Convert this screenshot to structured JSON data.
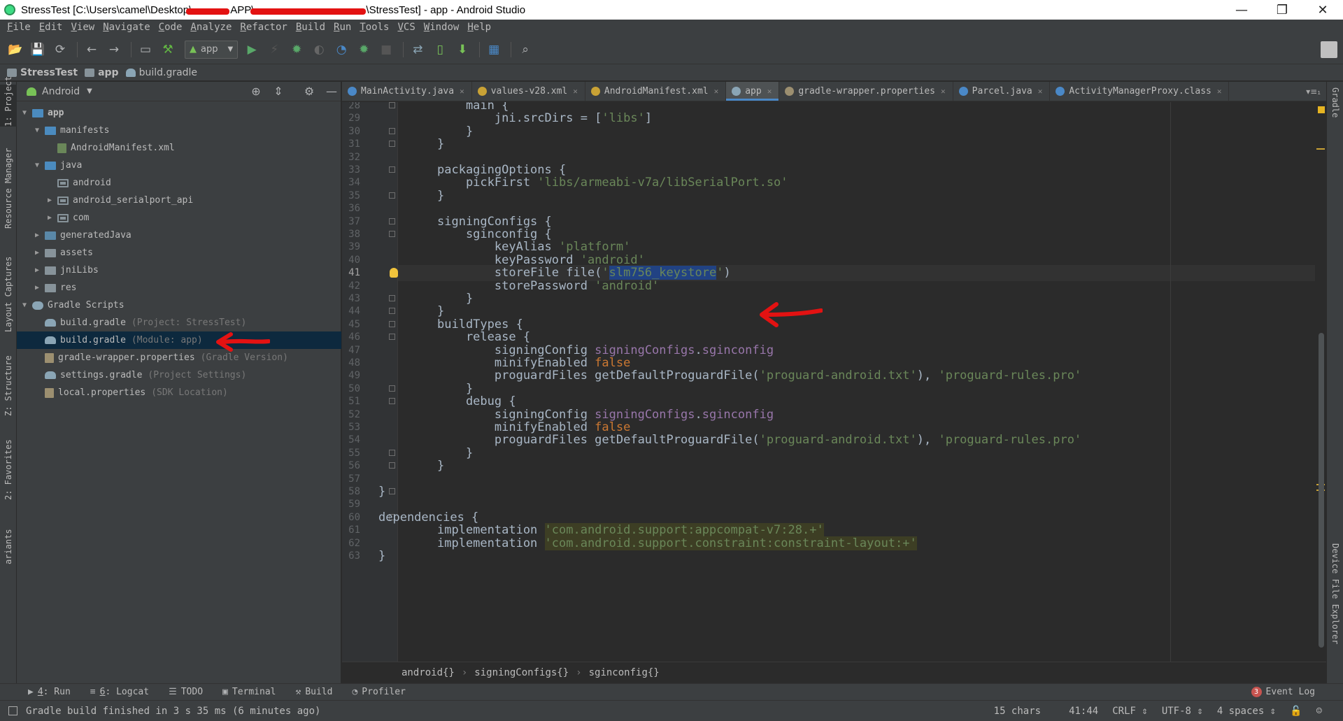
{
  "window": {
    "title_parts": [
      "StressTest [C:\\Users\\camel\\Desktop\\",
      "APP\\",
      "\\StressTest] - app - Android Studio"
    ],
    "controls": [
      "—",
      "❐",
      "✕"
    ]
  },
  "menu": [
    "File",
    "Edit",
    "View",
    "Navigate",
    "Code",
    "Analyze",
    "Refactor",
    "Build",
    "Run",
    "Tools",
    "VCS",
    "Window",
    "Help"
  ],
  "toolbar": {
    "run_config": "app"
  },
  "breadcrumb": [
    "StressTest",
    "app",
    "build.gradle"
  ],
  "left_strip": [
    "1: Project",
    "Resource Manager",
    "Layout Captures",
    "Z: Structure",
    "2: Favorites",
    "ariants"
  ],
  "right_strip": [
    "Gradle",
    "Device File Explorer"
  ],
  "project": {
    "view": "Android",
    "tree": [
      {
        "label": "app",
        "hint": "",
        "arrow": "▼",
        "level": 0,
        "icon": "folder-src",
        "bold": true
      },
      {
        "label": "manifests",
        "hint": "",
        "arrow": "▼",
        "level": 1,
        "icon": "folder-src"
      },
      {
        "label": "AndroidManifest.xml",
        "hint": "",
        "arrow": "",
        "level": 2,
        "icon": "manifest"
      },
      {
        "label": "java",
        "hint": "",
        "arrow": "▼",
        "level": 1,
        "icon": "folder-src"
      },
      {
        "label": "android",
        "hint": "",
        "arrow": "",
        "level": 2,
        "icon": "folder-pkg"
      },
      {
        "label": "android_serialport_api",
        "hint": "",
        "arrow": "▶",
        "level": 2,
        "icon": "folder-pkg"
      },
      {
        "label": "com",
        "hint": "",
        "arrow": "▶",
        "level": 2,
        "icon": "folder-pkg"
      },
      {
        "label": "generatedJava",
        "hint": "",
        "arrow": "▶",
        "level": 1,
        "icon": "folder-gen"
      },
      {
        "label": "assets",
        "hint": "",
        "arrow": "▶",
        "level": 1,
        "icon": "folder"
      },
      {
        "label": "jniLibs",
        "hint": "",
        "arrow": "▶",
        "level": 1,
        "icon": "folder"
      },
      {
        "label": "res",
        "hint": "",
        "arrow": "▶",
        "level": 1,
        "icon": "folder"
      },
      {
        "label": "Gradle Scripts",
        "hint": "",
        "arrow": "▼",
        "level": 0,
        "icon": "gscripts"
      },
      {
        "label": "build.gradle",
        "hint": "(Project: StressTest)",
        "arrow": "",
        "level": 1,
        "icon": "gradle"
      },
      {
        "label": "build.gradle",
        "hint": "(Module: app)",
        "arrow": "",
        "level": 1,
        "icon": "gradle",
        "selected": true
      },
      {
        "label": "gradle-wrapper.properties",
        "hint": "(Gradle Version)",
        "arrow": "",
        "level": 1,
        "icon": "props"
      },
      {
        "label": "settings.gradle",
        "hint": "(Project Settings)",
        "arrow": "",
        "level": 1,
        "icon": "gradle"
      },
      {
        "label": "local.properties",
        "hint": "(SDK Location)",
        "arrow": "",
        "level": 1,
        "icon": "props"
      }
    ]
  },
  "tabs": [
    {
      "label": "MainActivity.java",
      "color": "#4a88c7"
    },
    {
      "label": "values-v28.xml",
      "color": "#c9a235"
    },
    {
      "label": "AndroidManifest.xml",
      "color": "#c9a235"
    },
    {
      "label": "app",
      "color": "#8aa5b5",
      "active": true
    },
    {
      "label": "gradle-wrapper.properties",
      "color": "#9c8f70"
    },
    {
      "label": "Parcel.java",
      "color": "#4a88c7"
    },
    {
      "label": "ActivityManagerProxy.class",
      "color": "#4a88c7"
    }
  ],
  "tabs_overflow": "▾≡₁",
  "editor": {
    "current_line": 41,
    "lines": [
      {
        "n": 28,
        "fold": true,
        "segs": [
          [
            "    main {",
            ""
          ]
        ]
      },
      {
        "n": 29,
        "segs": [
          [
            "        jni.srcDirs = [",
            ""
          ],
          [
            "'libs'",
            "str"
          ],
          [
            "]",
            ""
          ]
        ]
      },
      {
        "n": 30,
        "fold": true,
        "segs": [
          [
            "    }",
            ""
          ]
        ]
      },
      {
        "n": 31,
        "fold": true,
        "segs": [
          [
            "}",
            ""
          ]
        ]
      },
      {
        "n": 32,
        "segs": [
          [
            "",
            ""
          ]
        ]
      },
      {
        "n": 33,
        "fold": true,
        "segs": [
          [
            "packagingOptions {",
            ""
          ]
        ]
      },
      {
        "n": 34,
        "segs": [
          [
            "    pickFirst ",
            ""
          ],
          [
            "'libs/armeabi-v7a/libSerialPort.so'",
            "str"
          ]
        ]
      },
      {
        "n": 35,
        "fold": true,
        "segs": [
          [
            "}",
            ""
          ]
        ]
      },
      {
        "n": 36,
        "segs": [
          [
            "",
            ""
          ]
        ]
      },
      {
        "n": 37,
        "fold": true,
        "segs": [
          [
            "signingConfigs {",
            ""
          ]
        ]
      },
      {
        "n": 38,
        "fold": true,
        "segs": [
          [
            "    sginconfig {",
            ""
          ]
        ]
      },
      {
        "n": 39,
        "segs": [
          [
            "        keyAlias ",
            ""
          ],
          [
            "'platform'",
            "str"
          ]
        ]
      },
      {
        "n": 40,
        "segs": [
          [
            "        keyPassword ",
            ""
          ],
          [
            "'android'",
            "str"
          ]
        ]
      },
      {
        "n": 41,
        "bulb": true,
        "segs": [
          [
            "        storeFile file(",
            ""
          ],
          [
            "'",
            "str"
          ],
          [
            "slm756_keystore",
            "str sel"
          ],
          [
            "'",
            "str"
          ],
          [
            ")",
            ""
          ]
        ]
      },
      {
        "n": 42,
        "segs": [
          [
            "        storePassword ",
            ""
          ],
          [
            "'android'",
            "str"
          ]
        ]
      },
      {
        "n": 43,
        "fold": true,
        "segs": [
          [
            "    }",
            ""
          ]
        ]
      },
      {
        "n": 44,
        "fold": true,
        "segs": [
          [
            "}",
            ""
          ]
        ]
      },
      {
        "n": 45,
        "fold": true,
        "segs": [
          [
            "buildTypes {",
            ""
          ]
        ]
      },
      {
        "n": 46,
        "fold": true,
        "segs": [
          [
            "    release {",
            ""
          ]
        ]
      },
      {
        "n": 47,
        "segs": [
          [
            "        signingConfig ",
            ""
          ],
          [
            "signingConfigs",
            "fld"
          ],
          [
            ".",
            ""
          ],
          [
            "sginconfig",
            "fld"
          ]
        ]
      },
      {
        "n": 48,
        "segs": [
          [
            "        minifyEnabled ",
            ""
          ],
          [
            "false",
            "kw"
          ]
        ]
      },
      {
        "n": 49,
        "segs": [
          [
            "        proguardFiles getDefaultProguardFile(",
            ""
          ],
          [
            "'proguard-android.txt'",
            "str"
          ],
          [
            "), ",
            ""
          ],
          [
            "'proguard-rules.pro'",
            "str"
          ]
        ]
      },
      {
        "n": 50,
        "fold": true,
        "segs": [
          [
            "    }",
            ""
          ]
        ]
      },
      {
        "n": 51,
        "fold": true,
        "segs": [
          [
            "    debug {",
            ""
          ]
        ]
      },
      {
        "n": 52,
        "segs": [
          [
            "        signingConfig ",
            ""
          ],
          [
            "signingConfigs",
            "fld"
          ],
          [
            ".",
            ""
          ],
          [
            "sginconfig",
            "fld"
          ]
        ]
      },
      {
        "n": 53,
        "segs": [
          [
            "        minifyEnabled ",
            ""
          ],
          [
            "false",
            "kw"
          ]
        ]
      },
      {
        "n": 54,
        "segs": [
          [
            "        proguardFiles getDefaultProguardFile(",
            ""
          ],
          [
            "'proguard-android.txt'",
            "str"
          ],
          [
            "), ",
            ""
          ],
          [
            "'proguard-rules.pro'",
            "str"
          ]
        ]
      },
      {
        "n": 55,
        "fold": true,
        "segs": [
          [
            "    }",
            ""
          ]
        ]
      },
      {
        "n": 56,
        "fold": true,
        "segs": [
          [
            "}",
            ""
          ]
        ]
      },
      {
        "n": 57,
        "segs": [
          [
            "",
            ""
          ]
        ]
      },
      {
        "n": 58,
        "fold": true,
        "base": -4,
        "segs": [
          [
            "}",
            ""
          ]
        ]
      },
      {
        "n": 59,
        "segs": [
          [
            "",
            ""
          ]
        ]
      },
      {
        "n": 60,
        "fold": true,
        "base": -4,
        "segs": [
          [
            "dependencies {",
            ""
          ]
        ]
      },
      {
        "n": 61,
        "segs": [
          [
            "implementation ",
            ""
          ],
          [
            "'com.android.support:appcompat-v7:28.+'",
            "strbg"
          ]
        ]
      },
      {
        "n": 62,
        "segs": [
          [
            "implementation ",
            ""
          ],
          [
            "'com.android.support.constraint:constraint-layout:+'",
            "strbg"
          ]
        ]
      },
      {
        "n": 63,
        "base": -4,
        "segs": [
          [
            "}",
            ""
          ]
        ]
      }
    ]
  },
  "editor_breadcrumb": [
    "android{}",
    "signingConfigs{}",
    "sginconfig{}"
  ],
  "bottom_tabs": [
    {
      "key": "4",
      "label": ": Run",
      "icon": "▶"
    },
    {
      "key": "6",
      "label": ": Logcat",
      "icon": "≡"
    },
    {
      "key": "",
      "label": "TODO",
      "icon": "☰"
    },
    {
      "key": "",
      "label": "Terminal",
      "icon": "▣"
    },
    {
      "key": "",
      "label": "Build",
      "icon": "⚒"
    },
    {
      "key": "",
      "label": "Profiler",
      "icon": "◔"
    }
  ],
  "event_log": {
    "count": "3",
    "label": "Event Log"
  },
  "status": {
    "message": "Gradle build finished in 3 s 35 ms (6 minutes ago)",
    "chars": "15 chars",
    "position": "41:44",
    "line_sep": "CRLF ⇕",
    "encoding": "UTF-8 ⇕",
    "indent": "4 spaces ⇕"
  }
}
